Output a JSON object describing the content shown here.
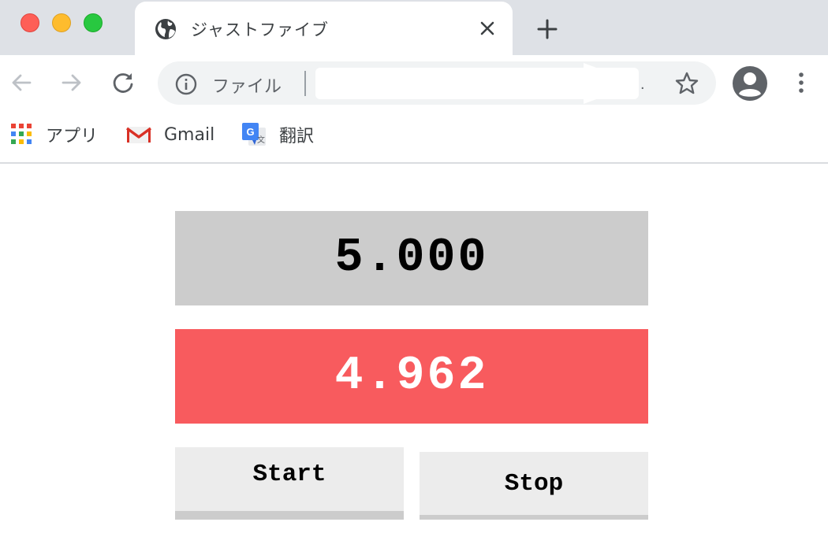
{
  "browser": {
    "tab": {
      "title": "ジャストファイブ"
    },
    "omnibox": {
      "scheme_label": "ファイル",
      "url_tail": "."
    },
    "bookmarks": [
      {
        "label": "アプリ",
        "icon": "apps-grid-icon"
      },
      {
        "label": "Gmail",
        "icon": "gmail-icon"
      },
      {
        "label": "翻訳",
        "icon": "google-translate-icon"
      }
    ]
  },
  "app": {
    "target_time": "5.000",
    "elapsed_time": "4.962",
    "start_label": "Start",
    "stop_label": "Stop",
    "colors": {
      "target_bg": "#cccccc",
      "elapsed_bg": "#f85b5e",
      "button_bg": "#ececec",
      "button_shadow": "#cccccc"
    }
  }
}
